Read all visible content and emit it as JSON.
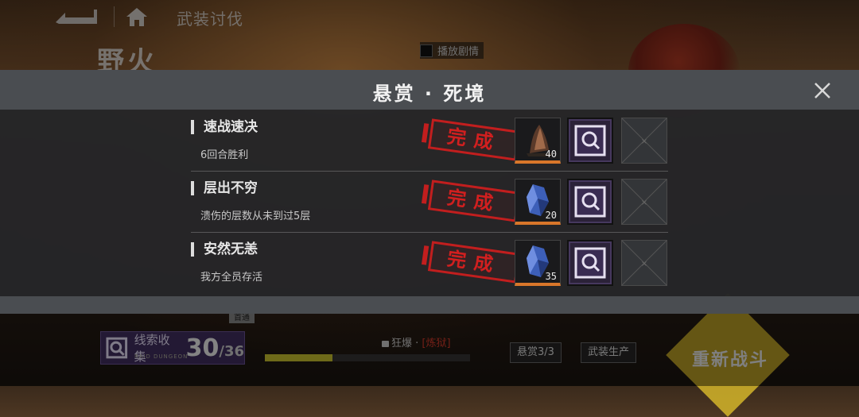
{
  "topbar": {
    "breadcrumb": "武装讨伐"
  },
  "stage": {
    "title": "野火",
    "play_story_label": "播放剧情"
  },
  "bottom": {
    "first_clear_tag": "首通",
    "clue_label": "线索收集",
    "clue_sub": "RAID DUNGEON",
    "clue_current": "30",
    "clue_total": "/36",
    "mode_prefix": "狂爆 ·",
    "mode_state": "[炼狱]",
    "progress_fraction": 0.33,
    "bounty_button": "悬赏3/3",
    "produce_button": "武装生产",
    "retry_label": "重新战斗"
  },
  "modal": {
    "title": "悬赏 · 死境",
    "tasks": [
      {
        "title": "速战速决",
        "desc": "6回合胜利",
        "stamp": "完成",
        "item_count": "40",
        "item_icon": "horn-icon"
      },
      {
        "title": "层出不穷",
        "desc": "溃伤的层数从未到过5层",
        "stamp": "完成",
        "item_count": "20",
        "item_icon": "blue-crystal-icon"
      },
      {
        "title": "安然无恙",
        "desc": "我方全员存活",
        "stamp": "完成",
        "item_count": "35",
        "item_icon": "blue-crystal-icon"
      }
    ]
  },
  "colors": {
    "stamp_red": "#c21e1e",
    "accent_orange": "#d9762a",
    "progress_yellow": "#c9c22e",
    "clue_purple": "#46385e"
  }
}
